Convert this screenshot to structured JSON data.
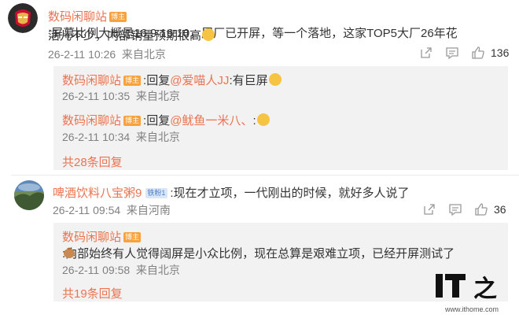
{
  "comments": [
    {
      "user": "数码闲聊站",
      "badge": "博主",
      "text_line1": ":屏幕比例大概是16:9 16:10，屏厂已开屏，等一个落地，这家TOP5大厂26年花",
      "text_line2": "活儿不少，内部销量预期很高",
      "time": "26-2-11 10:26",
      "location": "来自北京",
      "likes": "136",
      "replies": [
        {
          "user": "数码闲聊站",
          "badge": "博主",
          "prefix": ":回复",
          "mention": "@爱喵人JJ",
          "text": ":有巨屏",
          "time": "26-2-11 10:35",
          "location": "来自北京"
        },
        {
          "user": "数码闲聊站",
          "badge": "博主",
          "prefix": ":回复",
          "mention": "@鱿鱼一米八、",
          "text": ":",
          "time": "26-2-11 10:34",
          "location": "来自北京"
        }
      ],
      "more_replies": "共28条回复"
    },
    {
      "user": "啤酒饮料八宝粥9",
      "badge": "铁粉1",
      "text_line1": ":现在才立项，一代刚出的时候，就好多人说了",
      "time": "26-2-11 09:54",
      "location": "来自河南",
      "likes": "36",
      "replies": [
        {
          "user": "数码闲聊站",
          "badge": "博主",
          "text": ":内部始终有人觉得阔屏是小众比例，现在总算是艰难立项，已经开屏测试了",
          "time": "26-2-11 09:58",
          "location": "来自北京"
        }
      ],
      "more_replies": "共19条回复"
    }
  ],
  "watermark": {
    "logo": "IT之家",
    "url": "www.ithome.com"
  },
  "colors": {
    "name": "#eb7350",
    "reply_bg": "#f2f2f2",
    "meta": "#808080",
    "badge_blogger": "#f9a23b",
    "badge_fan": "#dbe6f7"
  },
  "icons": [
    "share-icon",
    "comment-icon",
    "like-icon"
  ]
}
